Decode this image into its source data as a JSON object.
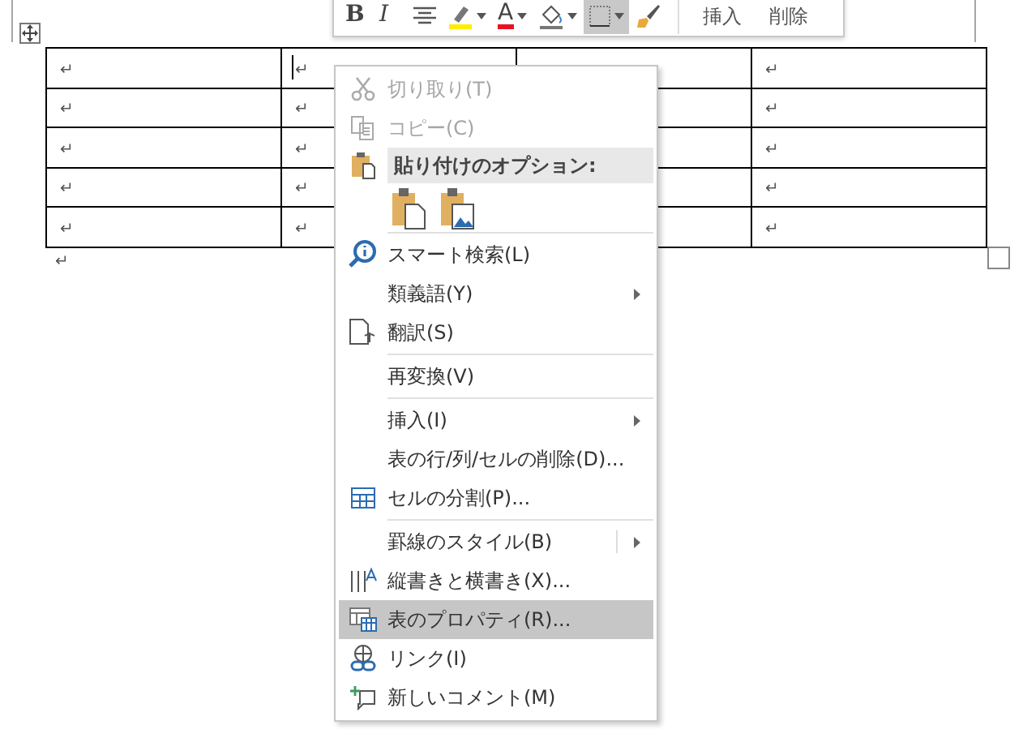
{
  "toolbar": {
    "buttons": [
      {
        "kind": "text",
        "label": "B",
        "bold": true
      },
      {
        "kind": "text",
        "label": "I",
        "italic": true
      },
      {
        "kind": "align"
      },
      {
        "kind": "highlight",
        "dropdown": true
      },
      {
        "kind": "text",
        "label": "A",
        "color": "#e81123",
        "dropdown": true
      },
      {
        "kind": "shading",
        "dropdown": true
      },
      {
        "kind": "borders",
        "dropdown": true,
        "selected": true
      },
      {
        "kind": "painter"
      },
      {
        "kind": "word",
        "label": "挿入"
      },
      {
        "kind": "word",
        "label": "削除"
      }
    ]
  },
  "table": {
    "rows": [
      [
        "↵",
        "↵",
        null,
        "↵"
      ],
      [
        "↵",
        "↵",
        null,
        "↵"
      ],
      [
        "↵",
        "↵",
        null,
        "↵"
      ],
      [
        "↵",
        "↵",
        null,
        "↵"
      ],
      [
        "↵",
        "↵",
        null,
        "↵"
      ]
    ]
  },
  "after_table": "↵",
  "context_menu": {
    "items": [
      {
        "kind": "item",
        "label": "切り取り(T)",
        "disabled": true
      },
      {
        "kind": "item",
        "label": "コピー(C)",
        "disabled": true
      },
      {
        "kind": "header",
        "label": "貼り付けのオプション:"
      },
      {
        "kind": "paste"
      },
      {
        "kind": "separator"
      },
      {
        "kind": "item",
        "label": "スマート検索(L)"
      },
      {
        "kind": "item",
        "label": "類義語(Y)",
        "submenu": true
      },
      {
        "kind": "item",
        "label": "翻訳(S)"
      },
      {
        "kind": "separator"
      },
      {
        "kind": "item",
        "label": "再変換(V)"
      },
      {
        "kind": "separator"
      },
      {
        "kind": "item",
        "label": "挿入(I)",
        "submenu": true
      },
      {
        "kind": "item",
        "label": "表の行/列/セルの削除(D)..."
      },
      {
        "kind": "item",
        "label": "セルの分割(P)..."
      },
      {
        "kind": "separator"
      },
      {
        "kind": "item",
        "label": "罫線のスタイル(B)",
        "submenu": true,
        "split": true
      },
      {
        "kind": "item",
        "label": "縦書きと横書き(X)..."
      },
      {
        "kind": "item",
        "label": "表のプロパティ(R)...",
        "selected": true
      },
      {
        "kind": "item",
        "label": "リンク(I)"
      },
      {
        "kind": "item",
        "label": "新しいコメント(M)"
      }
    ]
  }
}
